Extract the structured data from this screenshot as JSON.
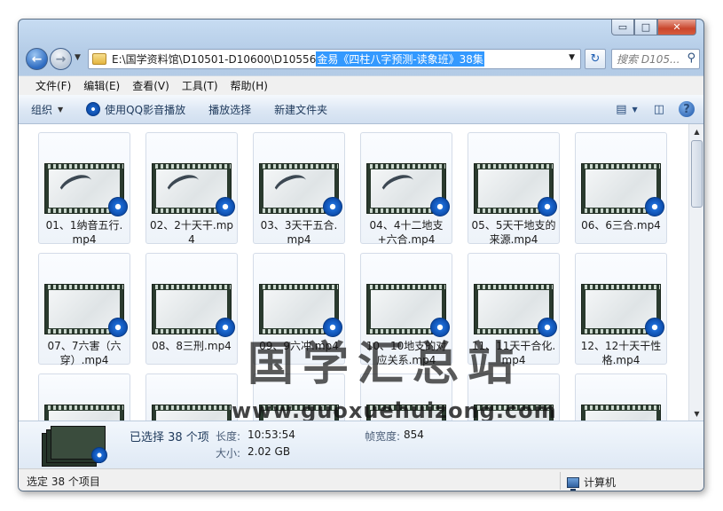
{
  "window": {
    "caption": {
      "minimize": "▭",
      "maximize": "□",
      "close": "✕"
    }
  },
  "address_bar": {
    "path_prefix": "E:\\国学资料馆\\D10501-D10600\\D10556 ",
    "path_selected": "金易《四柱八字预测-读象班》38集",
    "search_placeholder": "搜索 D105..."
  },
  "menu": [
    "文件(F)",
    "编辑(E)",
    "查看(V)",
    "工具(T)",
    "帮助(H)"
  ],
  "toolbar": {
    "organize": "组织",
    "play_with_qq": "使用QQ影音播放",
    "play_selection": "播放选择",
    "new_folder": "新建文件夹"
  },
  "files": [
    {
      "label": "01、1纳音五行.mp4",
      "ink": true
    },
    {
      "label": "02、2十天干.mp4",
      "ink": true
    },
    {
      "label": "03、3天干五合.mp4",
      "ink": true
    },
    {
      "label": "04、4十二地支+六合.mp4",
      "ink": true
    },
    {
      "label": "05、5天干地支的来源.mp4",
      "ink": false
    },
    {
      "label": "06、6三合.mp4",
      "ink": false
    },
    {
      "label": "07、7六害（六穿）.mp4",
      "ink": false
    },
    {
      "label": "08、8三刑.mp4",
      "ink": false
    },
    {
      "label": "09、9六冲.mp4",
      "ink": false
    },
    {
      "label": "10、10地支的对应关系.mp4",
      "ink": false
    },
    {
      "label": "11、11天干合化.mp4",
      "ink": false
    },
    {
      "label": "12、12十天干性格.mp4",
      "ink": false
    },
    {
      "label": "",
      "ink": false
    },
    {
      "label": "",
      "ink": false
    },
    {
      "label": "",
      "ink": false
    },
    {
      "label": "",
      "ink": false
    },
    {
      "label": "",
      "ink": false
    },
    {
      "label": "",
      "ink": false
    }
  ],
  "watermark": {
    "title": "国学汇总站",
    "url": "www.guoxuehuizong.com"
  },
  "details": {
    "selected_count": "已选择 38 个项",
    "length_label": "长度:",
    "length_value": "10:53:54",
    "size_label": "大小:",
    "size_value": "2.02 GB",
    "framewidth_label": "帧宽度:",
    "framewidth_value": "854"
  },
  "status": {
    "left": "选定 38 个项目",
    "right": "计算机"
  }
}
